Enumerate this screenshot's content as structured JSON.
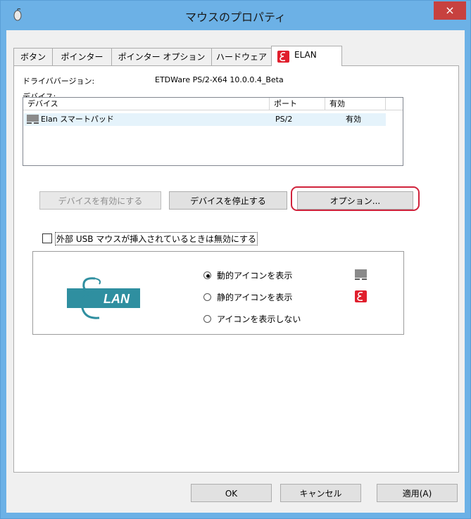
{
  "window": {
    "title": "マウスのプロパティ",
    "close_glyph": "×"
  },
  "tabs": [
    {
      "label": "ボタン"
    },
    {
      "label": "ポインター"
    },
    {
      "label": "ポインター オプション"
    },
    {
      "label": "ハードウェア"
    },
    {
      "label": "ELAN"
    }
  ],
  "driver": {
    "label": "ドライババージョン:",
    "value": "ETDWare PS/2-X64 10.0.0.4_Beta"
  },
  "devices_label": "デバイス:",
  "device_list": {
    "columns": [
      "デバイス",
      "ポート",
      "有効"
    ],
    "rows": [
      {
        "name": "Elan スマートパッド",
        "port": "PS/2",
        "enabled": "有効"
      }
    ]
  },
  "buttons": {
    "enable_device": "デバイスを有効にする",
    "stop_device": "デバイスを停止する",
    "options": "オプション..."
  },
  "disable_usb": {
    "label": "外部 USB マウスが挿入されているときは無効にする",
    "checked": false
  },
  "icon_display": {
    "options": [
      {
        "label": "動的アイコンを表示",
        "selected": true
      },
      {
        "label": "静的アイコンを表示",
        "selected": false
      },
      {
        "label": "アイコンを表示しない",
        "selected": false
      }
    ]
  },
  "logo": {
    "text": "LAN"
  },
  "footer": {
    "ok": "OK",
    "cancel": "キャンセル",
    "apply": "適用(A)"
  },
  "colors": {
    "titlebar": "#6cb1e6",
    "close": "#c7413f",
    "highlight": "#d0233c",
    "elan_red": "#e01f2d",
    "elan_teal": "#2f8fa0"
  }
}
